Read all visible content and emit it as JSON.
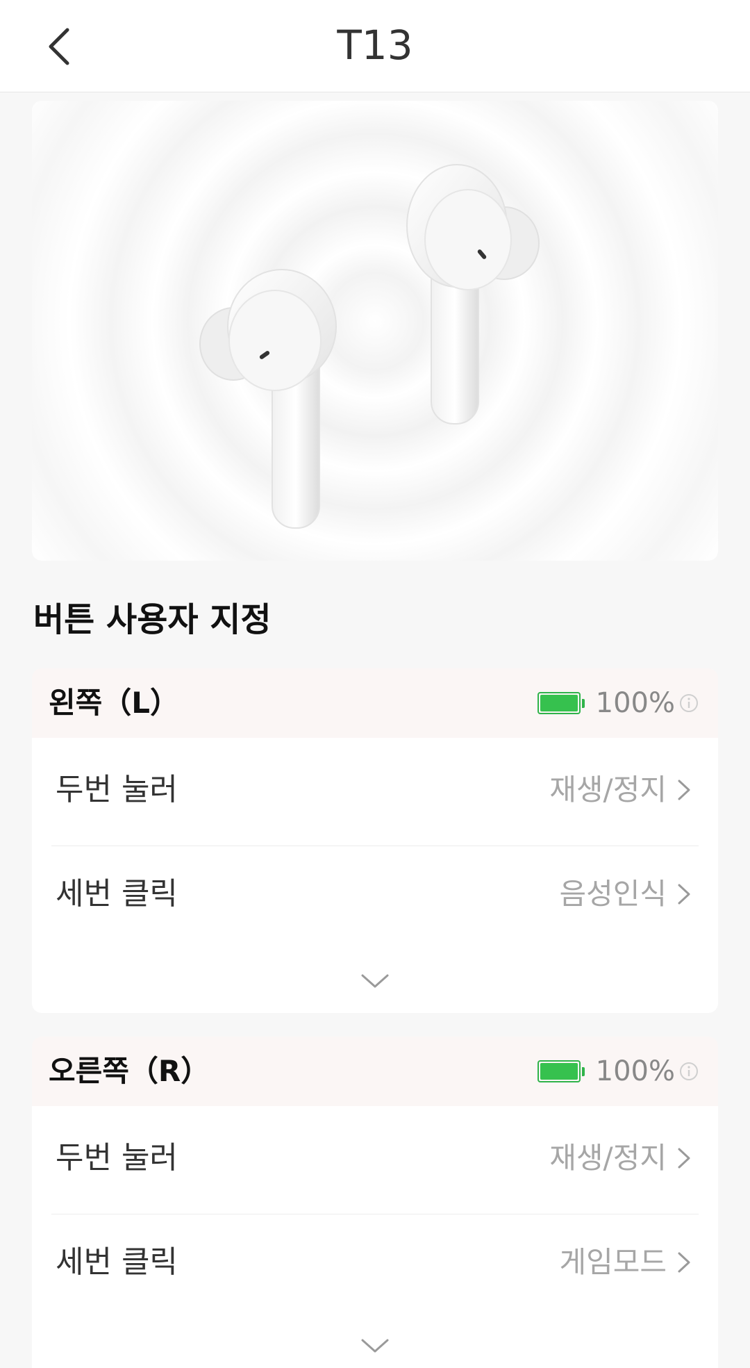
{
  "header": {
    "title": "T13",
    "back_icon": "chevron-left-icon"
  },
  "hero": {
    "image": "earbuds-image"
  },
  "section": {
    "title": "버튼 사용자 지정"
  },
  "left": {
    "label": "왼쪽（L）",
    "battery_percent": 100,
    "battery_text": "100%",
    "battery_color": "#36c14e",
    "rows": [
      {
        "label": "두번 눌러",
        "value": "재생/정지"
      },
      {
        "label": "세번 클릭",
        "value": "음성인식"
      }
    ]
  },
  "right": {
    "label": "오른쪽（R）",
    "battery_percent": 100,
    "battery_text": "100%",
    "battery_color": "#36c14e",
    "rows": [
      {
        "label": "두번 눌러",
        "value": "재생/정지"
      },
      {
        "label": "세번 클릭",
        "value": "게임모드"
      }
    ]
  }
}
